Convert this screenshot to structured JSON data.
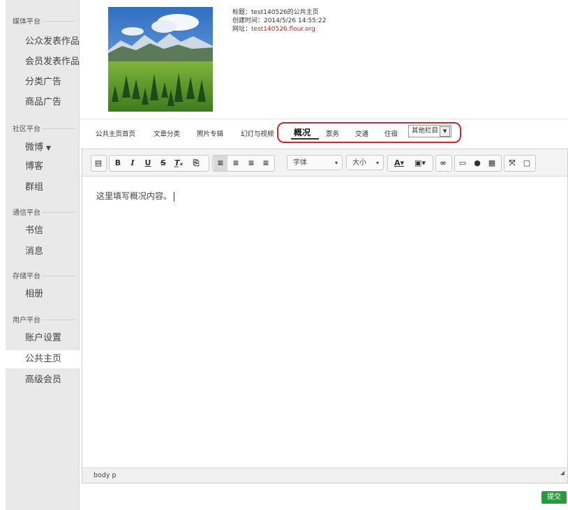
{
  "sidebar": {
    "sections": [
      {
        "title": "媒体平台",
        "items": [
          "公众发表作品",
          "会员发表作品",
          "分类广告",
          "商品广告"
        ]
      },
      {
        "title": "社区平台",
        "items": [
          "微博",
          "博客",
          "群组"
        ]
      },
      {
        "title": "通信平台",
        "items": [
          "书信",
          "消息"
        ]
      },
      {
        "title": "存储平台",
        "items": [
          "相册"
        ]
      },
      {
        "title": "用户平台",
        "items": [
          "账户设置",
          "公共主页",
          "高级会员"
        ]
      }
    ],
    "active_item": "公共主页"
  },
  "profile": {
    "title_label": "标题：",
    "title_value": "test140526的公共主页",
    "created_label": "创建时间：",
    "created_value": "2014/5/26 14:55:22",
    "url_label": "网址：",
    "url_value": "test140526.flour.org"
  },
  "tabs": {
    "items": [
      "公共主页首页",
      "文章分类",
      "照片专辑",
      "幻灯与视频",
      "概况",
      "票务",
      "交通",
      "住宿"
    ],
    "active": "概况",
    "more_select": "其他栏目"
  },
  "editor": {
    "toolbar": {
      "font_label": "字体",
      "size_label": "大小"
    },
    "content": "这里填写概况内容。",
    "status_path": "body  p"
  },
  "submit_label": "提交",
  "colors": {
    "highlight": "#d8232a",
    "submit_bg": "#2a9a3c",
    "url": "#cc2222"
  }
}
